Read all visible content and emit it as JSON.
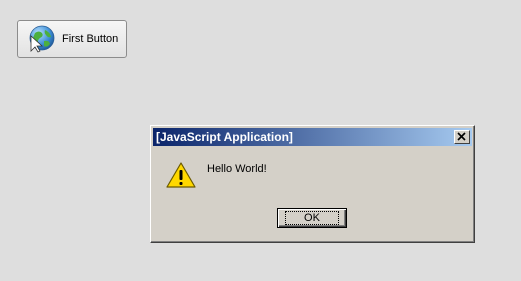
{
  "toolbar": {
    "first_button_label": "First Button",
    "first_button_icon": "globe-cursor-icon"
  },
  "dialog": {
    "title": "[JavaScript Application]",
    "message": "Hello World!",
    "ok_label": "OK",
    "icon": "warning-icon",
    "close_icon": "close-icon"
  },
  "colors": {
    "background": "#dedede",
    "dialog_face": "#d4d0c8",
    "titlebar_start": "#0a246a",
    "titlebar_end": "#a6caf0",
    "warning_yellow": "#ffd800"
  }
}
